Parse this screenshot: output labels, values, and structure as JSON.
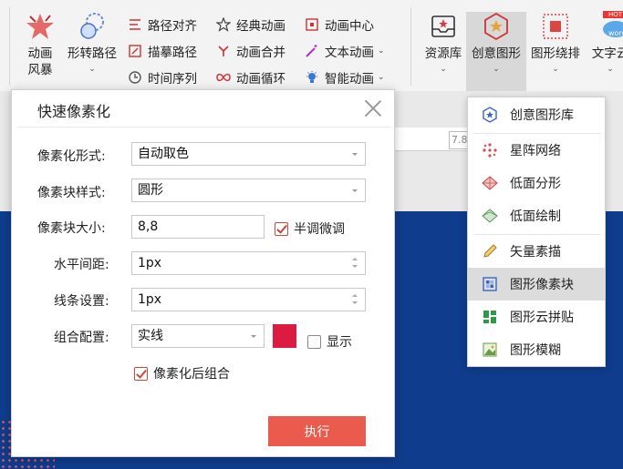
{
  "ribbon": {
    "left_big": [
      {
        "label1": "动画",
        "label2": "风暴"
      },
      {
        "label1": "形转路径",
        "caret": "⌄"
      }
    ],
    "col1": [
      "路径对齐",
      "描摹路径",
      "时间序列"
    ],
    "col2": [
      "经典动画",
      "动画合并",
      "动画循环"
    ],
    "col3": [
      {
        "label": "动画中心",
        "dd": ""
      },
      {
        "label": "文本动画",
        "dd": "⌄"
      },
      {
        "label": "智能动画",
        "dd": "⌄"
      }
    ],
    "right_big": [
      {
        "label": "资源库",
        "caret": "⌄"
      },
      {
        "label": "创意图形",
        "caret": "⌄"
      },
      {
        "label": "图形绕排",
        "caret": "⌄"
      },
      {
        "label": "文字云",
        "caret": "⌄"
      }
    ],
    "hot_badge": "HOT",
    "word_badge": "word",
    "zoom_value": "7.8"
  },
  "dialog": {
    "title": "快速像素化",
    "rows": {
      "form_label": "像素化形式:",
      "form_value": "自动取色",
      "style_label": "像素块样式:",
      "style_value": "圆形",
      "size_label": "像素块大小:",
      "size_value": "8,8",
      "halftone_label": "半调微调",
      "hspace_label": "水平间距:",
      "hspace_value": "1px",
      "line_label": "线条设置:",
      "line_value": "1px",
      "combo_label": "组合配置:",
      "combo_value": "实线",
      "show_label": "显示",
      "group_after_label": "像素化后组合"
    },
    "execute_label": "执行",
    "swatch_color": "#dc1b40",
    "button_color": "#ea5a4d"
  },
  "menu": {
    "items": [
      {
        "label": "创意图形库",
        "icon": "star-hexagon-icon"
      },
      {
        "label": "星阵网络",
        "icon": "dot-network-icon"
      },
      {
        "label": "低面分形",
        "icon": "lowpoly-fractal-icon"
      },
      {
        "label": "低面绘制",
        "icon": "lowpoly-draw-icon"
      },
      {
        "label": "矢量素描",
        "icon": "pencil-icon"
      },
      {
        "label": "图形像素块",
        "icon": "pixel-block-icon"
      },
      {
        "label": "图形云拼贴",
        "icon": "cloud-tile-icon"
      },
      {
        "label": "图形模糊",
        "icon": "blur-image-icon"
      }
    ]
  }
}
